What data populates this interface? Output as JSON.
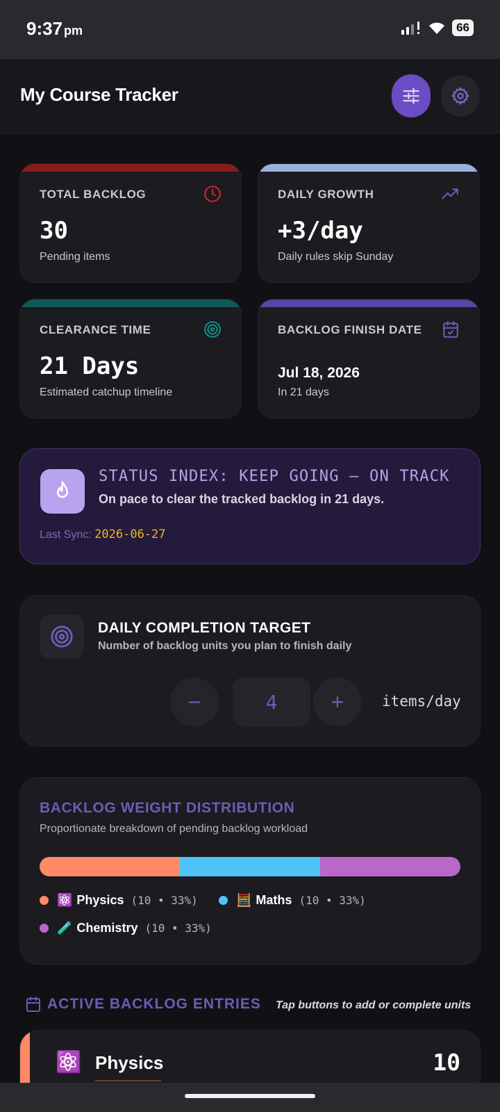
{
  "status_bar": {
    "time": "9:37",
    "ampm": "pm",
    "battery": "66"
  },
  "header": {
    "title": "My Course Tracker",
    "filter_icon": "sliders-icon",
    "settings_icon": "gear-icon"
  },
  "stats": [
    {
      "label": "TOTAL BACKLOG",
      "value": "30",
      "sub": "Pending items",
      "accent": "#8c1c1c",
      "icon": "clock-icon"
    },
    {
      "label": "DAILY GROWTH",
      "value": "+3/day",
      "sub": "Daily rules skip Sunday",
      "accent": "#9cb0de",
      "icon": "trending-up-icon"
    },
    {
      "label": "CLEARANCE TIME",
      "value": "21 Days",
      "sub": "Estimated catchup timeline",
      "accent": "#0e5a58",
      "icon": "target-icon"
    },
    {
      "label": "BACKLOG FINISH DATE",
      "value": "Jul 18, 2026",
      "sub": "In 21 days",
      "accent": "#5a45a0",
      "icon": "calendar-check-icon"
    }
  ],
  "status_index": {
    "title": "STATUS INDEX: KEEP GOING — ON TRACK",
    "subtitle": "On pace to clear the tracked backlog in 21 days.",
    "sync_label": "Last Sync:",
    "sync_date": "2026-06-27"
  },
  "target": {
    "title": "DAILY COMPLETION TARGET",
    "subtitle": "Number of backlog units you plan to finish daily",
    "minus": "−",
    "value": "4",
    "plus": "+",
    "unit": "items/day"
  },
  "distribution": {
    "title": "BACKLOG WEIGHT DISTRIBUTION",
    "subtitle": "Proportionate breakdown of pending backlog workload",
    "items": [
      {
        "emoji": "⚛️",
        "name": "Physics",
        "detail": "(10 • 33%)",
        "color": "#ff8a65",
        "fraction": 0.333
      },
      {
        "emoji": "🧮",
        "name": "Maths",
        "detail": "(10 • 33%)",
        "color": "#4fc3f7",
        "fraction": 0.333
      },
      {
        "emoji": "🧪",
        "name": "Chemistry",
        "detail": "(10 • 33%)",
        "color": "#ba68c8",
        "fraction": 0.334
      }
    ]
  },
  "entries": {
    "title": "ACTIVE BACKLOG ENTRIES",
    "hint": "Tap buttons to add or complete units",
    "items": [
      {
        "emoji": "⚛️",
        "name": "Physics",
        "count": "10"
      }
    ]
  }
}
